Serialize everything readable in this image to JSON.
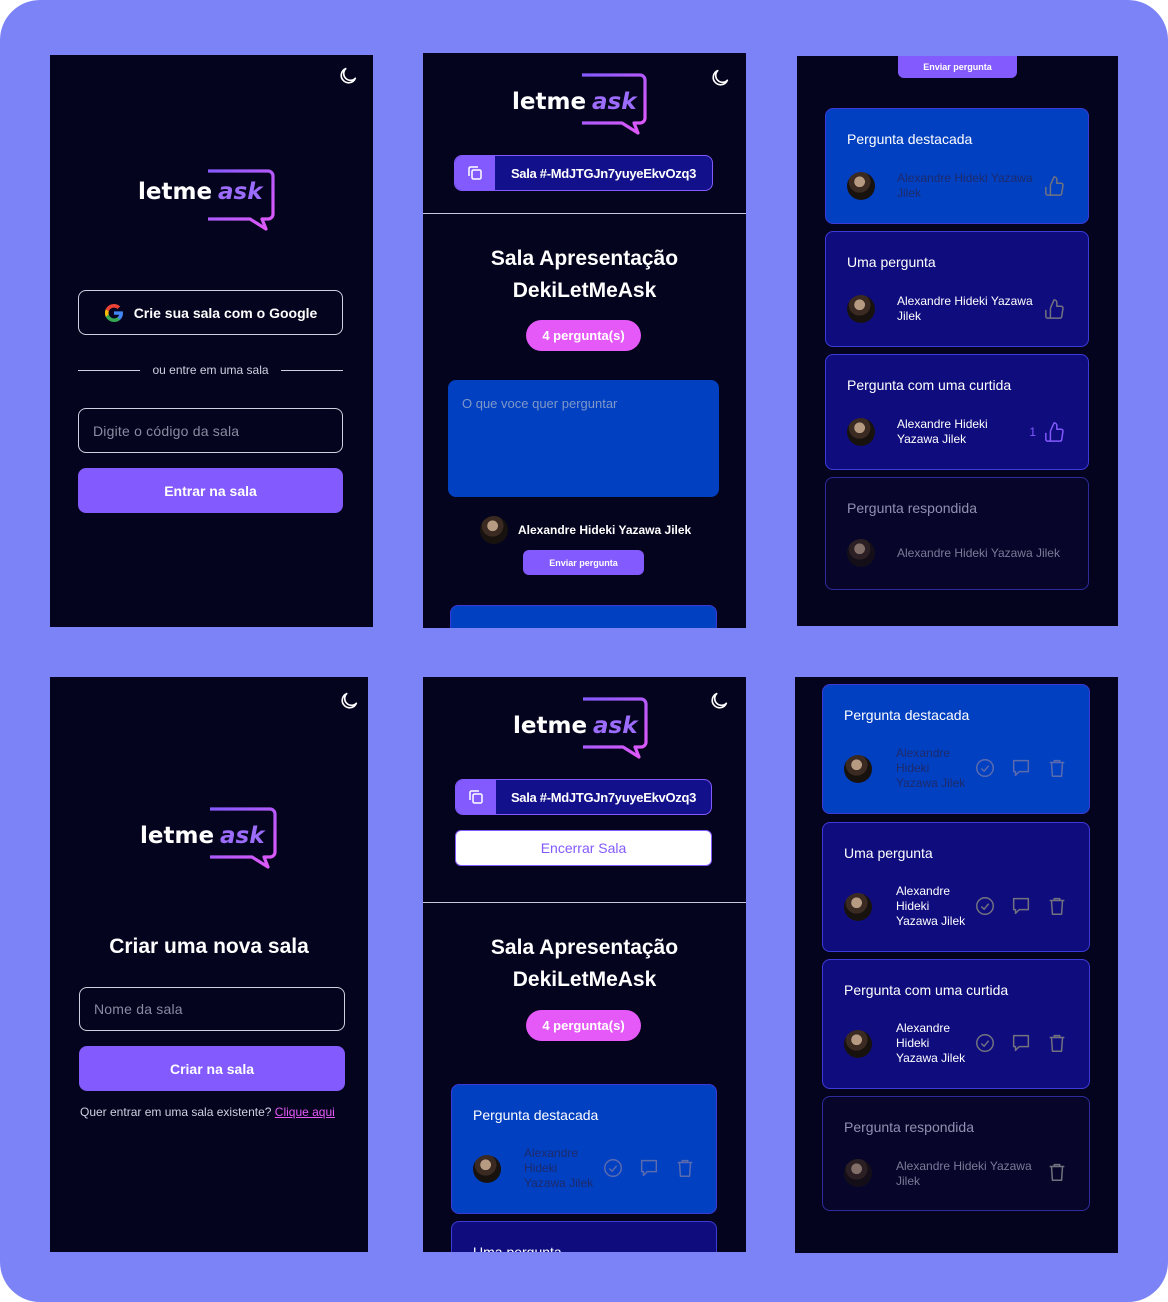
{
  "brand": {
    "logo_left": "letme",
    "logo_right": "ask"
  },
  "screen1": {
    "google_button": "Crie sua sala com o Google",
    "divider_text": "ou entre em uma sala",
    "code_placeholder": "Digite o código da sala",
    "enter_button": "Entrar na sala"
  },
  "screen2": {
    "room_code": "Sala #-MdJTGJn7yuyeEkvOzq3",
    "room_title_line1": "Sala Apresentação",
    "room_title_line2": "DekiLetMeAsk",
    "questions_badge": "4 pergunta(s)",
    "textarea_placeholder": "O que voce quer perguntar",
    "user_name": "Alexandre Hideki Yazawa Jilek",
    "send_button": "Enviar pergunta"
  },
  "screen3": {
    "send_button": "Enviar pergunta",
    "cards": [
      {
        "question": "Pergunta destacada",
        "author_line1": "Alexandre Hideki Yazawa",
        "author_line2": "Jilek",
        "likes": ""
      },
      {
        "question": "Uma pergunta",
        "author_line1": "Alexandre Hideki Yazawa",
        "author_line2": "Jilek",
        "likes": ""
      },
      {
        "question": "Pergunta com uma curtida",
        "author_line1": "Alexandre Hideki",
        "author_line2": "Yazawa Jilek",
        "likes": "1"
      },
      {
        "question": "Pergunta respondida",
        "author_line1": "Alexandre Hideki Yazawa Jilek",
        "author_line2": "",
        "likes": ""
      }
    ]
  },
  "screen4": {
    "heading": "Criar uma nova sala",
    "name_placeholder": "Nome da sala",
    "create_button": "Criar na sala",
    "footer_text": "Quer entrar em uma sala existente?",
    "footer_link": "Clique aqui"
  },
  "screen5": {
    "room_code": "Sala #-MdJTGJn7yuyeEkvOzq3",
    "close_button": "Encerrar Sala",
    "room_title_line1": "Sala Apresentação",
    "room_title_line2": "DekiLetMeAsk",
    "questions_badge": "4 pergunta(s)",
    "card1_question": "Pergunta destacada",
    "card1_author_1": "Alexandre",
    "card1_author_2": "Hideki",
    "card1_author_3": "Yazawa Jilek",
    "card2_question": "Uma pergunta"
  },
  "screen6": {
    "cards": [
      {
        "question": "Pergunta destacada",
        "a1": "Alexandre",
        "a2": "Hideki",
        "a3": "Yazawa Jilek"
      },
      {
        "question": "Uma pergunta",
        "a1": "Alexandre",
        "a2": "Hideki",
        "a3": "Yazawa Jilek"
      },
      {
        "question": "Pergunta com uma curtida",
        "a1": "Alexandre",
        "a2": "Hideki",
        "a3": "Yazawa Jilek"
      },
      {
        "question": "Pergunta respondida",
        "a1": "Alexandre Hideki Yazawa",
        "a2": "Jilek",
        "a3": ""
      }
    ]
  },
  "colors": {
    "background": "#7b83f7",
    "screen": "#05041e",
    "primary": "#835afd",
    "accent_pink": "#e559f9",
    "highlight_card": "#0040c1",
    "card": "#0f0c7e"
  }
}
